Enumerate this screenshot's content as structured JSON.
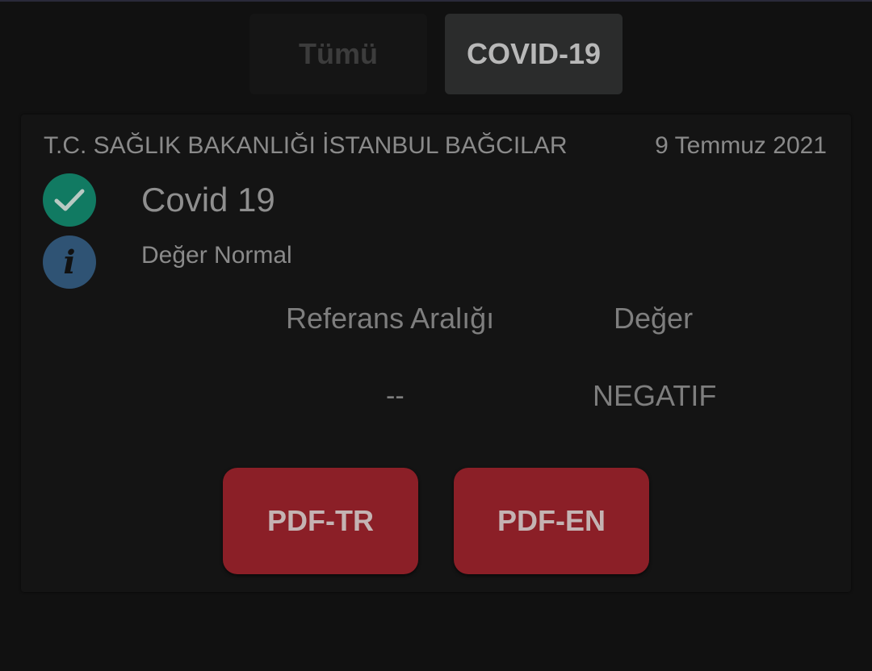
{
  "tabs": [
    {
      "label": "Tümü",
      "selected": false
    },
    {
      "label": "COVID-19",
      "selected": true
    }
  ],
  "result_card": {
    "institution": "T.C. SAĞLIK BAKANLIĞI İSTANBUL BAĞCILAR",
    "date": "9 Temmuz 2021",
    "test_name": "Covid 19",
    "status_icon": "check-icon",
    "info_icon": "info-icon",
    "info_icon_glyph": "i",
    "status_text": "Değer Normal",
    "table": {
      "headers": [
        "Referans Aralığı",
        "Değer"
      ],
      "rows": [
        [
          "--",
          "NEGATIF"
        ]
      ]
    },
    "buttons": {
      "pdf_tr": "PDF-TR",
      "pdf_en": "PDF-EN"
    }
  },
  "colors": {
    "background": "#111111",
    "check_green": "#117a62",
    "info_blue": "#2f5374",
    "button_red": "#8b1f27"
  }
}
